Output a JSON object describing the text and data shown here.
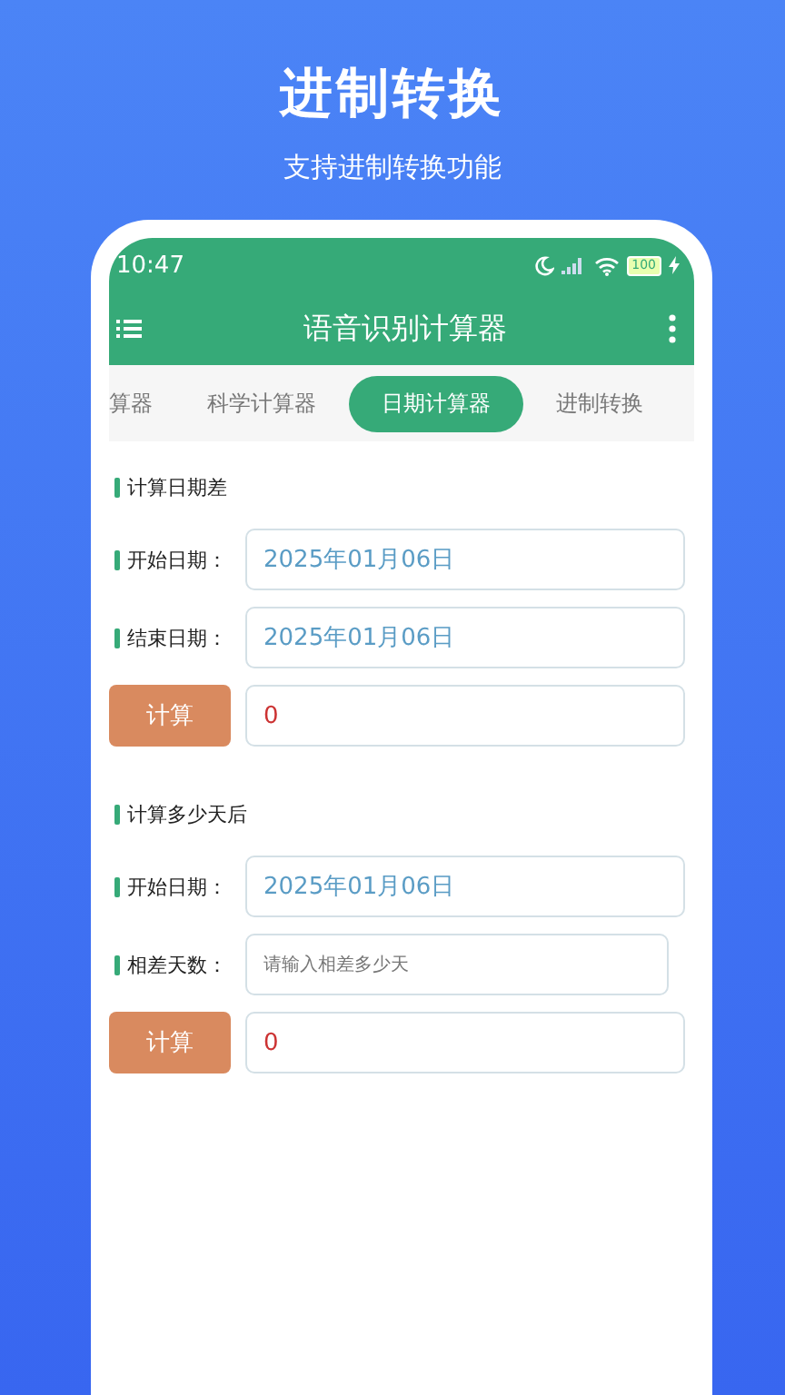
{
  "header": {
    "title": "进制转换",
    "subtitle": "支持进制转换功能"
  },
  "status_bar": {
    "time": "10:47",
    "battery": "100"
  },
  "app_bar": {
    "title": "语音识别计算器"
  },
  "tabs": [
    {
      "label": "算器",
      "selected": false
    },
    {
      "label": "科学计算器",
      "selected": false
    },
    {
      "label": "日期计算器",
      "selected": true
    },
    {
      "label": "进制转换",
      "selected": false
    }
  ],
  "sections": [
    {
      "title": "计算日期差",
      "rows": [
        {
          "kind": "field",
          "label": "开始日期：",
          "value": "2025年01月06日"
        },
        {
          "kind": "field",
          "label": "结束日期：",
          "value": "2025年01月06日"
        },
        {
          "kind": "result",
          "button": "计算",
          "value": "0"
        }
      ]
    },
    {
      "title": "计算多少天后",
      "rows": [
        {
          "kind": "field",
          "label": "开始日期：",
          "value": "2025年01月06日"
        },
        {
          "kind": "input",
          "label": "相差天数：",
          "placeholder": "请输入相差多少天"
        },
        {
          "kind": "result",
          "button": "计算",
          "value": "0"
        }
      ]
    }
  ]
}
